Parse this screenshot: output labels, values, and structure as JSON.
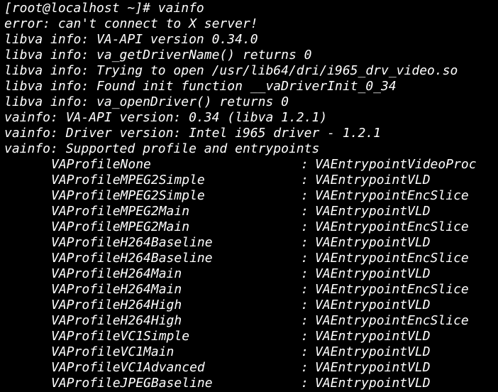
{
  "window": {
    "background": "#000000",
    "foreground": "#ffffff"
  },
  "prompt": "[root@localhost ~]# vainfo",
  "output_lines": [
    "error: can't connect to X server!",
    "libva info: VA-API version 0.34.0",
    "libva info: va_getDriverName() returns 0",
    "libva info: Trying to open /usr/lib64/dri/i965_drv_video.so",
    "libva info: Found init function __vaDriverInit_0_34",
    "libva info: va_openDriver() returns 0",
    "vainfo: VA-API version: 0.34 (libva 1.2.1)",
    "vainfo: Driver version: Intel i965 driver - 1.2.1",
    "vainfo: Supported profile and entrypoints"
  ],
  "separator": ":",
  "profiles": [
    {
      "profile": "VAProfileNone",
      "entrypoint": "VAEntrypointVideoProc"
    },
    {
      "profile": "VAProfileMPEG2Simple",
      "entrypoint": "VAEntrypointVLD"
    },
    {
      "profile": "VAProfileMPEG2Simple",
      "entrypoint": "VAEntrypointEncSlice"
    },
    {
      "profile": "VAProfileMPEG2Main",
      "entrypoint": "VAEntrypointVLD"
    },
    {
      "profile": "VAProfileMPEG2Main",
      "entrypoint": "VAEntrypointEncSlice"
    },
    {
      "profile": "VAProfileH264Baseline",
      "entrypoint": "VAEntrypointVLD"
    },
    {
      "profile": "VAProfileH264Baseline",
      "entrypoint": "VAEntrypointEncSlice"
    },
    {
      "profile": "VAProfileH264Main",
      "entrypoint": "VAEntrypointVLD"
    },
    {
      "profile": "VAProfileH264Main",
      "entrypoint": "VAEntrypointEncSlice"
    },
    {
      "profile": "VAProfileH264High",
      "entrypoint": "VAEntrypointVLD"
    },
    {
      "profile": "VAProfileH264High",
      "entrypoint": "VAEntrypointEncSlice"
    },
    {
      "profile": "VAProfileVC1Simple",
      "entrypoint": "VAEntrypointVLD"
    },
    {
      "profile": "VAProfileVC1Main",
      "entrypoint": "VAEntrypointVLD"
    },
    {
      "profile": "VAProfileVC1Advanced",
      "entrypoint": "VAEntrypointVLD"
    },
    {
      "profile": "VAProfileJPEGBaseline",
      "entrypoint": "VAEntrypointVLD"
    }
  ]
}
